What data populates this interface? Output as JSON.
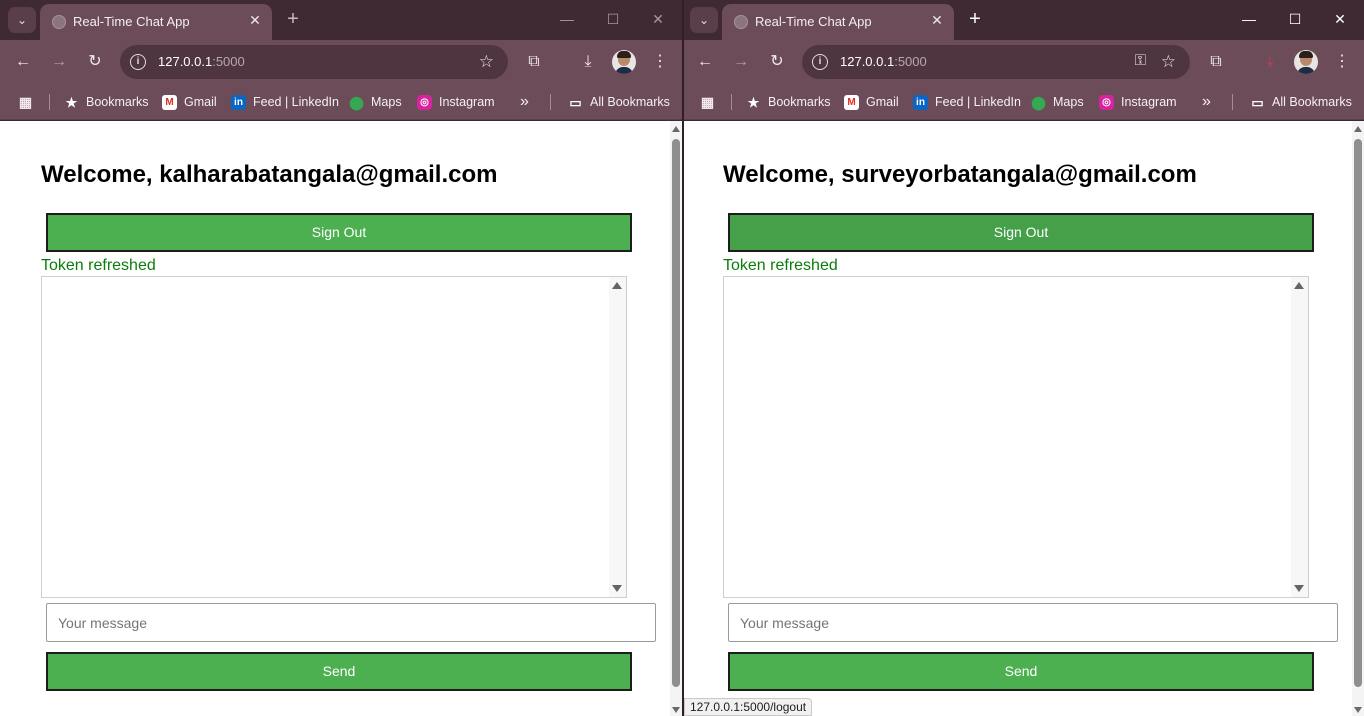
{
  "windows": [
    {
      "tab_title": "Real-Time Chat App",
      "url_host": "127.0.0.1",
      "url_port": ":5000",
      "welcome_text": "Welcome, kalharabatangala@gmail.com",
      "signout_label": "Sign Out",
      "status_text": "Token refreshed",
      "message_placeholder": "Your message",
      "send_label": "Send"
    },
    {
      "tab_title": "Real-Time Chat App",
      "url_host": "127.0.0.1",
      "url_port": ":5000",
      "welcome_text": "Welcome, surveyorbatangala@gmail.com",
      "signout_label": "Sign Out",
      "status_text": "Token refreshed",
      "message_placeholder": "Your message",
      "send_label": "Send"
    }
  ],
  "bookmarks": {
    "items": [
      "Bookmarks",
      "Gmail",
      "Feed | LinkedIn",
      "Maps",
      "Instagram"
    ],
    "overflow": "»",
    "all_label": "All Bookmarks"
  },
  "status_bar_url": "127.0.0.1:5000/logout",
  "colors": {
    "browser_frame": "#3f2a34",
    "toolbar": "#6b4c58",
    "button_green": "#4caf50",
    "status_green": "#0a7d0a"
  }
}
